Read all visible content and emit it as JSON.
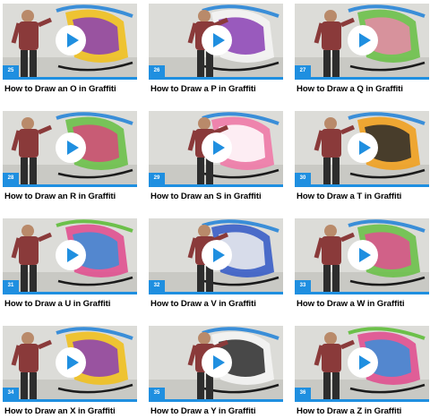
{
  "videos": [
    {
      "title": "How to Draw an O in Graffiti",
      "number": "25",
      "play_icon": "play-icon",
      "colors": [
        "#f0c020",
        "#8a3fb4",
        "#3a8ed8"
      ]
    },
    {
      "title": "How to Draw a P in Graffiti",
      "number": "26",
      "play_icon": "play-icon",
      "colors": [
        "#f4f4f4",
        "#8a3fb4",
        "#3a8ed8"
      ]
    },
    {
      "title": "How to Draw a Q in Graffiti",
      "number": "27",
      "play_icon": "play-icon",
      "colors": [
        "#6cc04a",
        "#e88aa8",
        "#3a8ed8"
      ]
    },
    {
      "title": "How to Draw an R in Graffiti",
      "number": "28",
      "play_icon": "play-icon",
      "colors": [
        "#6cc04a",
        "#d64a7a",
        "#3a8ed8"
      ]
    },
    {
      "title": "How to Draw an S in Graffiti",
      "number": "29",
      "play_icon": "play-icon",
      "colors": [
        "#f07aa8",
        "#ffffff",
        "#3a8ed8"
      ]
    },
    {
      "title": "How to Draw a T in Graffiti",
      "number": "30",
      "play_icon": "play-icon",
      "colors": [
        "#f0a020",
        "#2a2a2a",
        "#3a8ed8"
      ]
    },
    {
      "title": "How to Draw a U in Graffiti",
      "number": "31",
      "play_icon": "play-icon",
      "colors": [
        "#e05090",
        "#3a8ed8",
        "#6cc04a"
      ]
    },
    {
      "title": "How to Draw a V in Graffiti",
      "number": "32",
      "play_icon": "play-icon",
      "colors": [
        "#3a5ec8",
        "#f0f0f0",
        "#3a8ed8"
      ]
    },
    {
      "title": "How to Draw a W in Graffiti",
      "number": "33",
      "play_icon": "play-icon",
      "colors": [
        "#6cc04a",
        "#e05090",
        "#3a8ed8"
      ]
    },
    {
      "title": "How to Draw an X in Graffiti",
      "number": "34",
      "play_icon": "play-icon",
      "colors": [
        "#f0c020",
        "#8a3fb4",
        "#3a8ed8"
      ]
    },
    {
      "title": "How to Draw a Y in Graffiti",
      "number": "35",
      "play_icon": "play-icon",
      "colors": [
        "#f4f4f4",
        "#2a2a2a",
        "#3a8ed8"
      ]
    },
    {
      "title": "How to Draw a Z in Graffiti",
      "number": "36",
      "play_icon": "play-icon",
      "colors": [
        "#e05090",
        "#3a8ed8",
        "#6cc04a"
      ]
    }
  ],
  "theme": {
    "accent": "#1f8fe0",
    "play_button": "#ffffff",
    "play_triangle": "#1f8fe0",
    "title_color": "#000000"
  }
}
